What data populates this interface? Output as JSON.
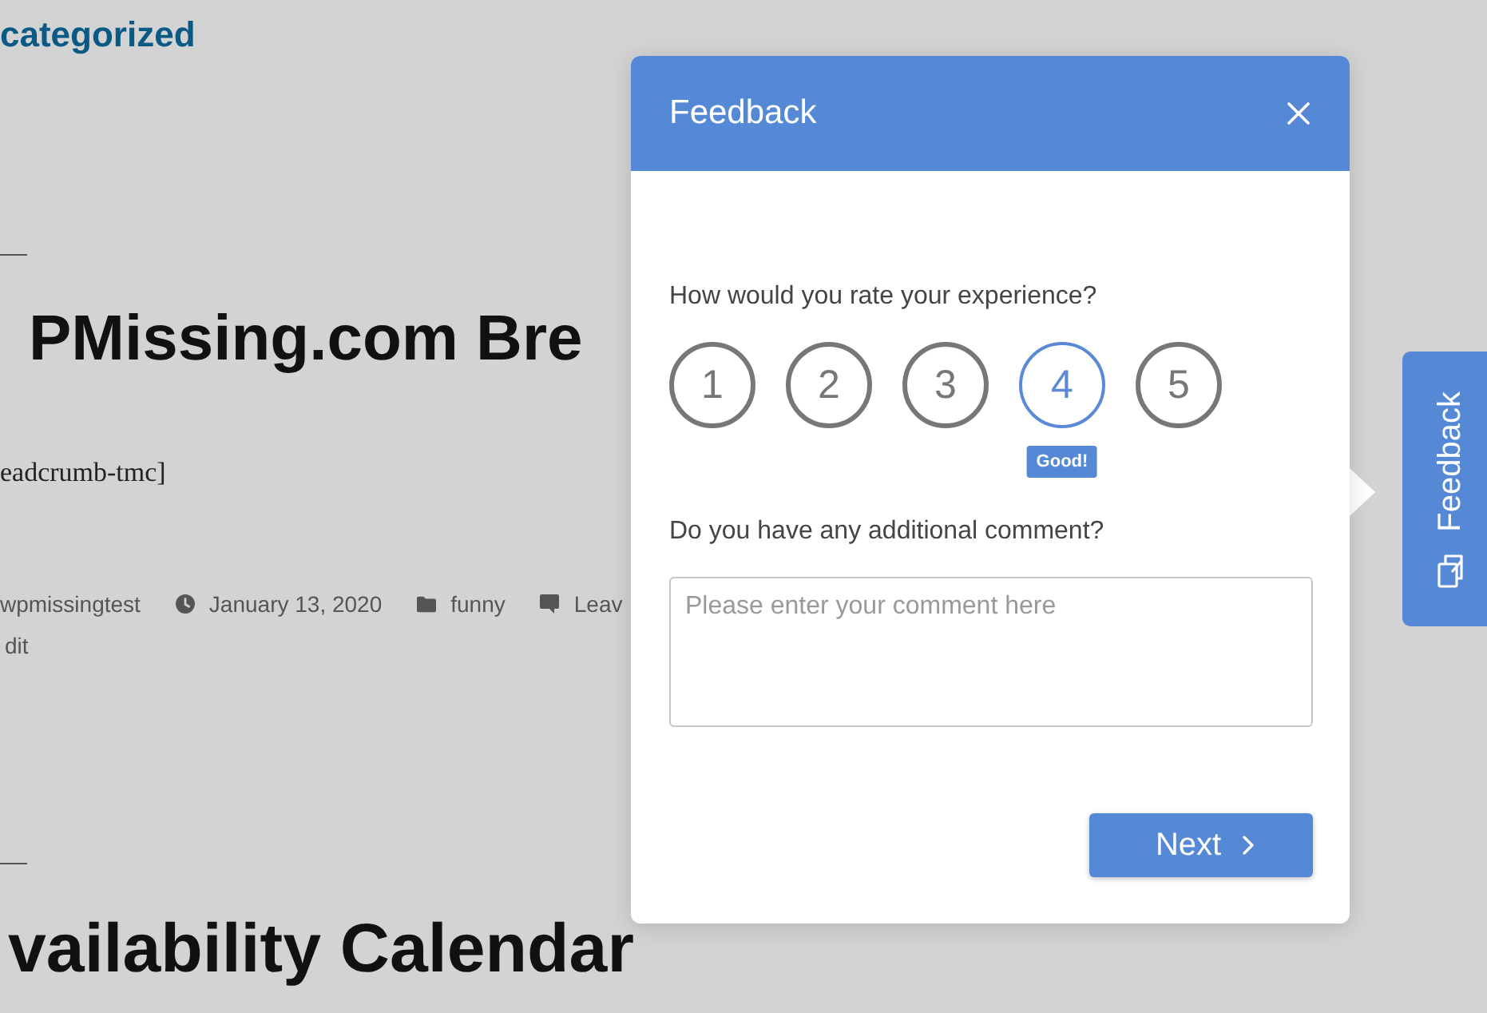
{
  "page": {
    "category_link": "categorized",
    "posts": [
      {
        "title": "PMissing.com Bre",
        "shortcode": "eadcrumb-tmc]",
        "meta": [
          {
            "kind": "author",
            "text": "wpmissingtest"
          },
          {
            "kind": "date",
            "text": "January 13, 2020"
          },
          {
            "kind": "category",
            "text": "funny"
          },
          {
            "kind": "comments",
            "text": "Leav"
          }
        ],
        "edit_link": "dit"
      },
      {
        "title": "vailability Calendar"
      }
    ]
  },
  "feedback_dialog": {
    "title": "Feedback",
    "question": "How would you rate your experience?",
    "ratings": [
      {
        "label": "1",
        "selected": false
      },
      {
        "label": "2",
        "selected": false
      },
      {
        "label": "3",
        "selected": false
      },
      {
        "label": "4",
        "selected": true
      },
      {
        "label": "5",
        "selected": false
      }
    ],
    "rating_tooltip": "Good!",
    "comment_label": "Do you have any additional comment?",
    "comment": {
      "placeholder": "Please enter your comment here"
    },
    "next_button": "Next"
  },
  "feedback_tab": {
    "label": "Feedback"
  }
}
